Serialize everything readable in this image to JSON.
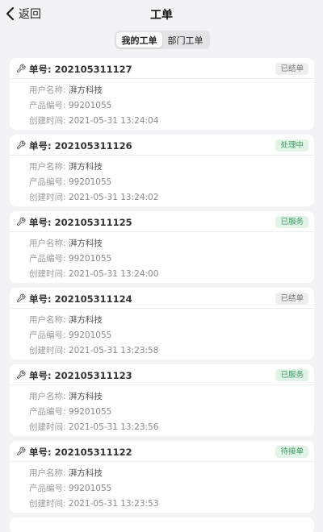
{
  "nav": {
    "back_label": "返回",
    "title": "工单"
  },
  "tabs": [
    {
      "label": "我的工单",
      "active": true
    },
    {
      "label": "部门工单",
      "active": false
    }
  ],
  "labels": {
    "order_prefix": "单号: ",
    "user": "用户名称: ",
    "product": "产品编号: ",
    "created": "创建时间: "
  },
  "status_colors": {
    "已结单": {
      "bg": "#eeeeee",
      "fg": "#777777"
    },
    "处理中": {
      "bg": "#e2f3e8",
      "fg": "#3a9d5d"
    },
    "已服务": {
      "bg": "#e2f3e8",
      "fg": "#3a9d5d"
    },
    "待接单": {
      "bg": "#e2f3e8",
      "fg": "#3a9d5d"
    }
  },
  "orders": [
    {
      "order_no": "202105311127",
      "status": "已结单",
      "user_name": "湃方科技",
      "product_no": "99201055",
      "created_time": "2021-05-31 13:24:04"
    },
    {
      "order_no": "202105311126",
      "status": "处理中",
      "user_name": "湃方科技",
      "product_no": "99201055",
      "created_time": "2021-05-31 13:24:02"
    },
    {
      "order_no": "202105311125",
      "status": "已服务",
      "user_name": "湃方科技",
      "product_no": "99201055",
      "created_time": "2021-05-31 13:24:00"
    },
    {
      "order_no": "202105311124",
      "status": "已结单",
      "user_name": "湃方科技",
      "product_no": "99201055",
      "created_time": "2021-05-31 13:23:58"
    },
    {
      "order_no": "202105311123",
      "status": "已服务",
      "user_name": "湃方科技",
      "product_no": "99201055",
      "created_time": "2021-05-31 13:23:56"
    },
    {
      "order_no": "202105311122",
      "status": "待接单",
      "user_name": "湃方科技",
      "product_no": "99201055",
      "created_time": "2021-05-31 13:23:53"
    }
  ]
}
